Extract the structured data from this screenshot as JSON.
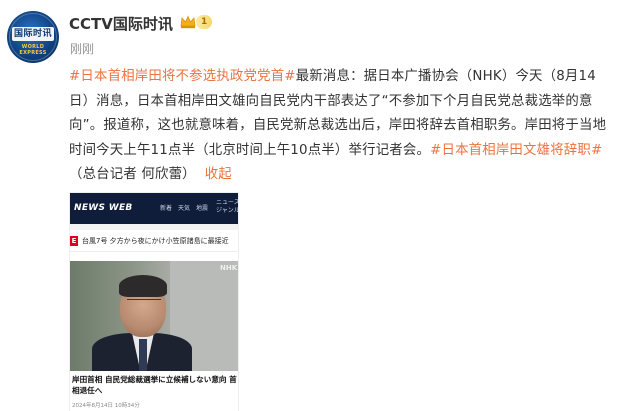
{
  "account": {
    "name": "CCTV国际时讯",
    "level": "1",
    "time": "刚刚",
    "avatar_logo_text": "国际时讯",
    "avatar_sub_text": "WORLD EXPRESS"
  },
  "post": {
    "hashtag_1": "#日本首相岸田将不参选执政党党首#",
    "text_1": "最新消息：据日本广播协会（NHK）今天（8月14日）消息，日本首相岸田文雄向自民党内干部表达了“不参加下个月自民党总裁选举的意向”。报道称，这也就意味着，自民党新总裁选出后，岸田将辞去首相职务。岸田将于当地时间今天上午11点半（北京时间上午10点半）举行记者会。",
    "hashtag_2": "#日本首相岸田文雄将辞职#",
    "text_2": "（总台记者 何欣蕾）",
    "collapse_label": "收起"
  },
  "image_card": {
    "site_logo": "NEWS WEB",
    "menu": [
      "新着",
      "天気",
      "地震",
      "ニュース ジャンル"
    ],
    "ticker_mark": "E",
    "ticker_text": "台風7号 夕方から夜にかけ小笠原諸島に最接近",
    "watermark": "NHK",
    "title": "岸田首相 自民党総裁選挙に立候補しない意向 首相退任へ",
    "meta": "2024年8月14日 10時34分"
  },
  "colors": {
    "link": "#eb7340",
    "text": "#333333",
    "muted": "#939393",
    "nhk_bar": "#0f1c3a"
  },
  "icons": [
    "crown-icon"
  ]
}
